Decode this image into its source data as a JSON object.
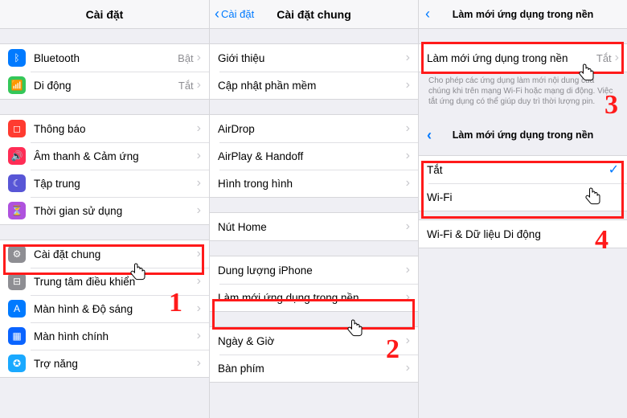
{
  "pane1": {
    "title": "Cài đặt",
    "group1": [
      {
        "icon": "bluetooth",
        "color": "bg-blue",
        "label": "Bluetooth",
        "value": "Bật"
      },
      {
        "icon": "cellular",
        "color": "bg-green",
        "label": "Di động",
        "value": "Tắt"
      }
    ],
    "group2": [
      {
        "icon": "bell",
        "color": "bg-red",
        "label": "Thông báo"
      },
      {
        "icon": "sound",
        "color": "bg-pink",
        "label": "Âm thanh & Cảm ứng"
      },
      {
        "icon": "moon",
        "color": "bg-indigo",
        "label": "Tập trung"
      },
      {
        "icon": "hourglass",
        "color": "bg-purple",
        "label": "Thời gian sử dụng"
      }
    ],
    "group3": [
      {
        "icon": "gear",
        "color": "bg-gray",
        "label": "Cài đặt chung"
      },
      {
        "icon": "switches",
        "color": "bg-gray",
        "label": "Trung tâm điều khiển"
      },
      {
        "icon": "display",
        "color": "bg-blue",
        "label": "Màn hình & Độ sáng"
      },
      {
        "icon": "home",
        "color": "bg-dblue",
        "label": "Màn hình chính"
      },
      {
        "icon": "access",
        "color": "bg-lblue",
        "label": "Trợ năng"
      }
    ]
  },
  "pane2": {
    "back": "Cài đặt",
    "title": "Cài đặt chung",
    "group1": [
      {
        "label": "Giới thiệu"
      },
      {
        "label": "Cập nhật phần mềm"
      }
    ],
    "group2": [
      {
        "label": "AirDrop"
      },
      {
        "label": "AirPlay & Handoff"
      },
      {
        "label": "Hình trong hình"
      }
    ],
    "group3": [
      {
        "label": "Nút Home"
      }
    ],
    "group4": [
      {
        "label": "Dung lượng iPhone"
      },
      {
        "label": "Làm mới ứng dụng trong nền"
      }
    ],
    "group5": [
      {
        "label": "Ngày & Giờ"
      },
      {
        "label": "Bàn phím"
      }
    ]
  },
  "pane3": {
    "title": "Làm mới ứng dụng trong nền",
    "row1_label": "Làm mới ứng dụng trong nền",
    "row1_value": "Tắt",
    "hint": "Cho phép các ứng dụng làm mới nội dung của chúng khi trên mạng Wi-Fi hoặc mạng di động. Việc tắt ứng dụng có thể giúp duy trì thời lượng pin.",
    "sub_title": "Làm mới ứng dụng trong nền",
    "options": [
      {
        "label": "Tắt",
        "checked": true
      },
      {
        "label": "Wi-Fi",
        "checked": false
      }
    ],
    "extra_row": "Wi-Fi & Dữ liệu Di động"
  },
  "steps": {
    "s1": "1",
    "s2": "2",
    "s3": "3",
    "s4": "4"
  }
}
